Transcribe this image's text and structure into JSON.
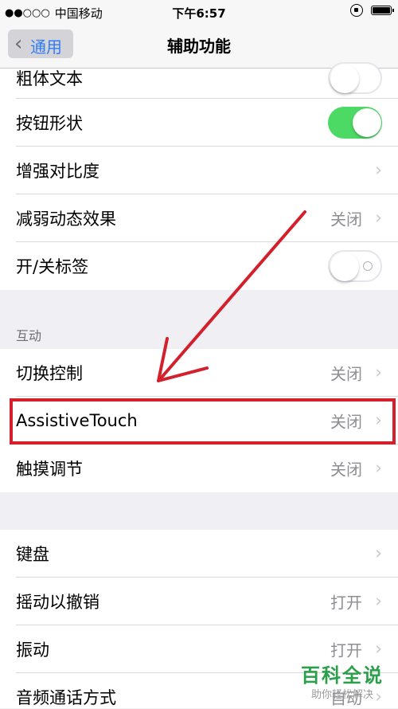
{
  "status_bar": {
    "signal_dots": "●●○○○",
    "carrier": "中国移动",
    "time": "下午6:57",
    "icons": [
      "rotation-lock-icon",
      "battery-icon"
    ]
  },
  "nav": {
    "back_label": "通用",
    "title": "辅助功能"
  },
  "group1": [
    {
      "label": "粗体文本",
      "type": "toggle",
      "state": "off"
    },
    {
      "label": "按钮形状",
      "type": "toggle",
      "state": "on"
    },
    {
      "label": "增强对比度",
      "type": "chevron"
    },
    {
      "label": "减弱动态效果",
      "type": "value",
      "value": "关闭"
    },
    {
      "label": "开/关标签",
      "type": "toggle",
      "state": "off"
    }
  ],
  "section_interaction": {
    "header": "互动",
    "items": [
      {
        "label": "切换控制",
        "value": "关闭"
      },
      {
        "label": "AssistiveTouch",
        "value": "关闭"
      },
      {
        "label": "触摸调节",
        "value": "关闭"
      }
    ]
  },
  "group3": [
    {
      "label": "键盘",
      "type": "chevron"
    },
    {
      "label": "摇动以撤销",
      "type": "value",
      "value": "打开"
    },
    {
      "label": "振动",
      "type": "value",
      "value": "打开"
    },
    {
      "label": "音频通话方式",
      "type": "value",
      "value": "自动"
    }
  ],
  "watermark": {
    "title": "百科全说",
    "subtitle": "助你轻松解决"
  },
  "colors": {
    "accent": "#2f7cf6",
    "toggle_on": "#4cd964",
    "annotation_red": "#d3202c",
    "watermark_green": "#2aa04a"
  }
}
